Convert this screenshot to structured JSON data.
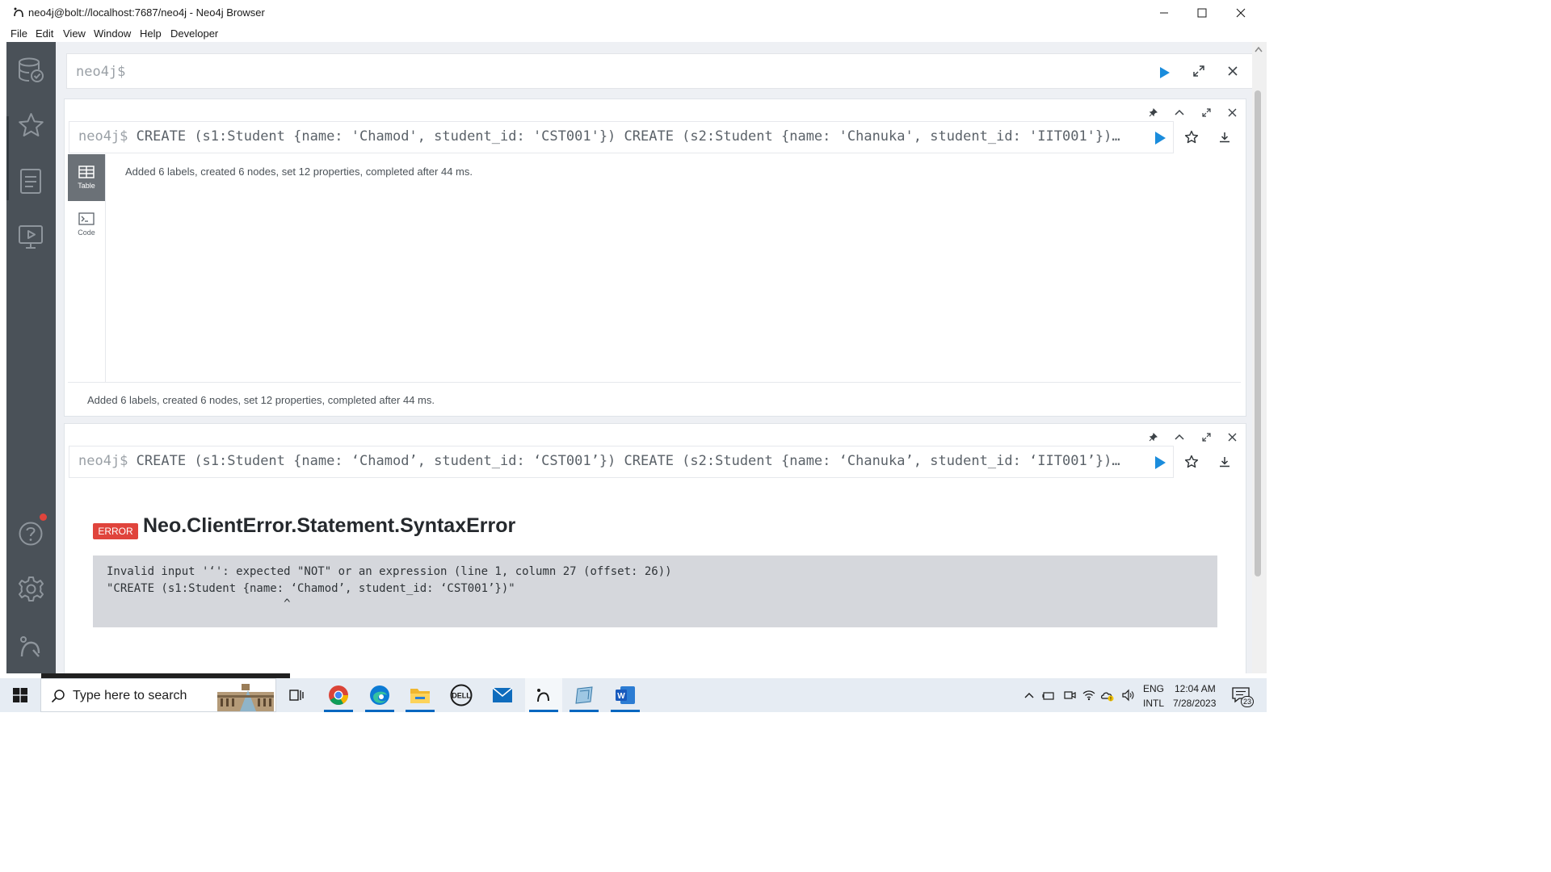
{
  "window": {
    "title": "neo4j@bolt://localhost:7687/neo4j - Neo4j Browser",
    "menu": [
      "File",
      "Edit",
      "View",
      "Window",
      "Help",
      "Developer"
    ]
  },
  "sidebar": {
    "items": [
      "database-icon",
      "favorites-star-icon",
      "documents-icon",
      "guides-monitor-icon",
      "help-icon",
      "settings-gear-icon",
      "neo4j-logo-icon"
    ],
    "help_has_notification": true,
    "notification_color": "#e0443c"
  },
  "editor": {
    "prompt": "neo4j$"
  },
  "frames": [
    {
      "prompt": "neo4j$",
      "command": "CREATE (s1:Student {name: 'Chamod', student_id: 'CST001'}) CREATE (s2:Student {name: 'Chanuka', student_id: 'IIT001'})…",
      "view_tabs": [
        {
          "label": "Table",
          "active": true
        },
        {
          "label": "Code",
          "active": false
        }
      ],
      "message": "Added 6 labels, created 6 nodes, set 12 properties, completed after 44 ms.",
      "footer": "Added 6 labels, created 6 nodes, set 12 properties, completed after 44 ms."
    },
    {
      "prompt": "neo4j$",
      "command": "CREATE (s1:Student {name: ‘Chamod’, student_id: ‘CST001’}) CREATE (s2:Student {name: ‘Chanuka’, student_id: ‘IIT001’})…",
      "error": {
        "badge": "ERROR",
        "code": "Neo.ClientError.Statement.SyntaxError",
        "lines": [
          "Invalid input '‘': expected \"NOT\" or an expression (line 1, column 27 (offset: 26))",
          "\"CREATE (s1:Student {name: ‘Chamod’, student_id: ‘CST001’})\"",
          "                          ^"
        ]
      }
    }
  ],
  "taskbar": {
    "search_placeholder": "Type here to search",
    "apps": [
      "task-view",
      "chrome",
      "edge",
      "file-explorer",
      "dell",
      "mail",
      "neo4j-browser",
      "app-blue",
      "word"
    ],
    "active_app": "neo4j-browser",
    "lang_top": "ENG",
    "lang_bottom": "INTL",
    "time": "12:04 AM",
    "date": "7/28/2023",
    "notification_count": "23"
  },
  "colors": {
    "accent_blue": "#1a8cdc",
    "error_red": "#e0443c",
    "sidebar": "#4a5158"
  }
}
